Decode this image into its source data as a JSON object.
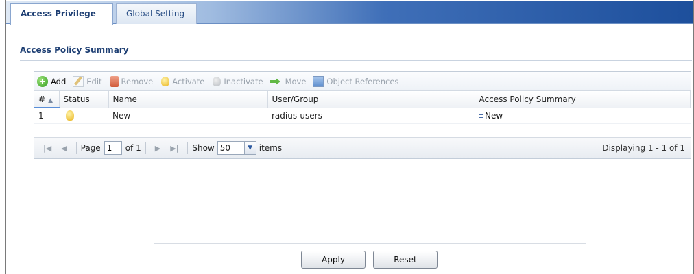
{
  "tabs": [
    {
      "label": "Access Privilege",
      "active": true
    },
    {
      "label": "Global Setting",
      "active": false
    }
  ],
  "section": {
    "title": "Access Policy Summary"
  },
  "toolbar": {
    "add": "Add",
    "edit": "Edit",
    "remove": "Remove",
    "activate": "Activate",
    "inactivate": "Inactivate",
    "move": "Move",
    "object_references": "Object References"
  },
  "table": {
    "columns": [
      "#",
      "Status",
      "Name",
      "User/Group",
      "Access Policy Summary"
    ],
    "rows": [
      {
        "index": "1",
        "status": "active",
        "name": "New",
        "user_group": "radius-users",
        "summary": "New"
      }
    ]
  },
  "pager": {
    "page_label": "Page",
    "page_value": "1",
    "of_label": "of 1",
    "show_label": "Show",
    "show_value": "50",
    "items_label": "items",
    "display_text": "Displaying 1 - 1 of 1"
  },
  "buttons": {
    "apply": "Apply",
    "reset": "Reset"
  },
  "colors": {
    "accent": "#1e3f73",
    "tabbar_end": "#1d4f9c",
    "bulb_on": "#e9b41e"
  }
}
